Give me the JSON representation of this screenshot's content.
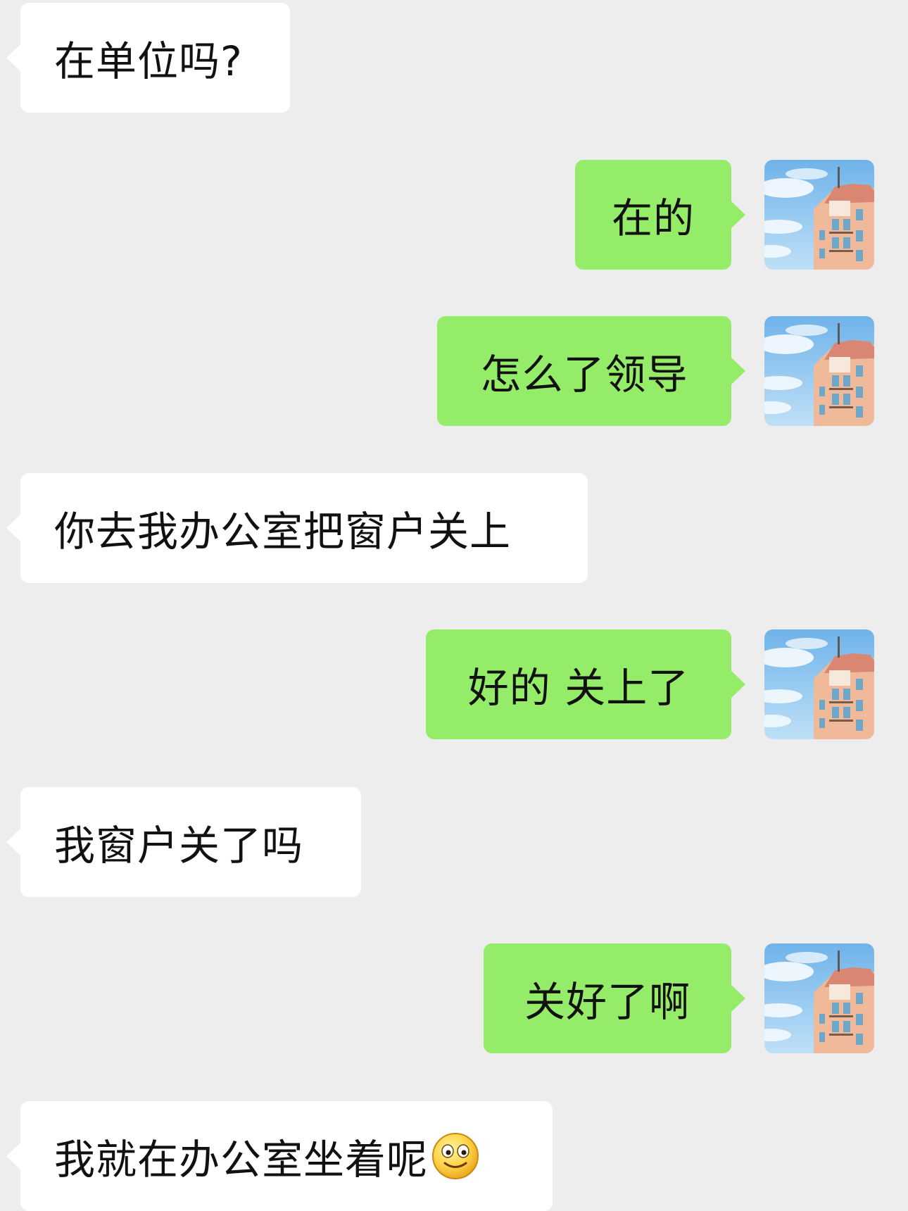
{
  "messages": [
    {
      "side": "incoming",
      "text": "在单位吗?"
    },
    {
      "side": "outgoing",
      "text": "在的"
    },
    {
      "side": "outgoing",
      "text": "怎么了领导"
    },
    {
      "side": "incoming",
      "text": "你去我办公室把窗户关上"
    },
    {
      "side": "outgoing",
      "text": "好的 关上了"
    },
    {
      "side": "incoming",
      "text": "我窗户关了吗"
    },
    {
      "side": "outgoing",
      "text": "关好了啊"
    },
    {
      "side": "incoming",
      "text": "我就在办公室坐着呢",
      "emoji": "smile-emoji"
    }
  ],
  "avatar": {
    "icon": "building-sky-avatar"
  },
  "colors": {
    "background": "#ededed",
    "incoming_bubble": "#ffffff",
    "outgoing_bubble": "#95ec69",
    "text": "#111111"
  }
}
